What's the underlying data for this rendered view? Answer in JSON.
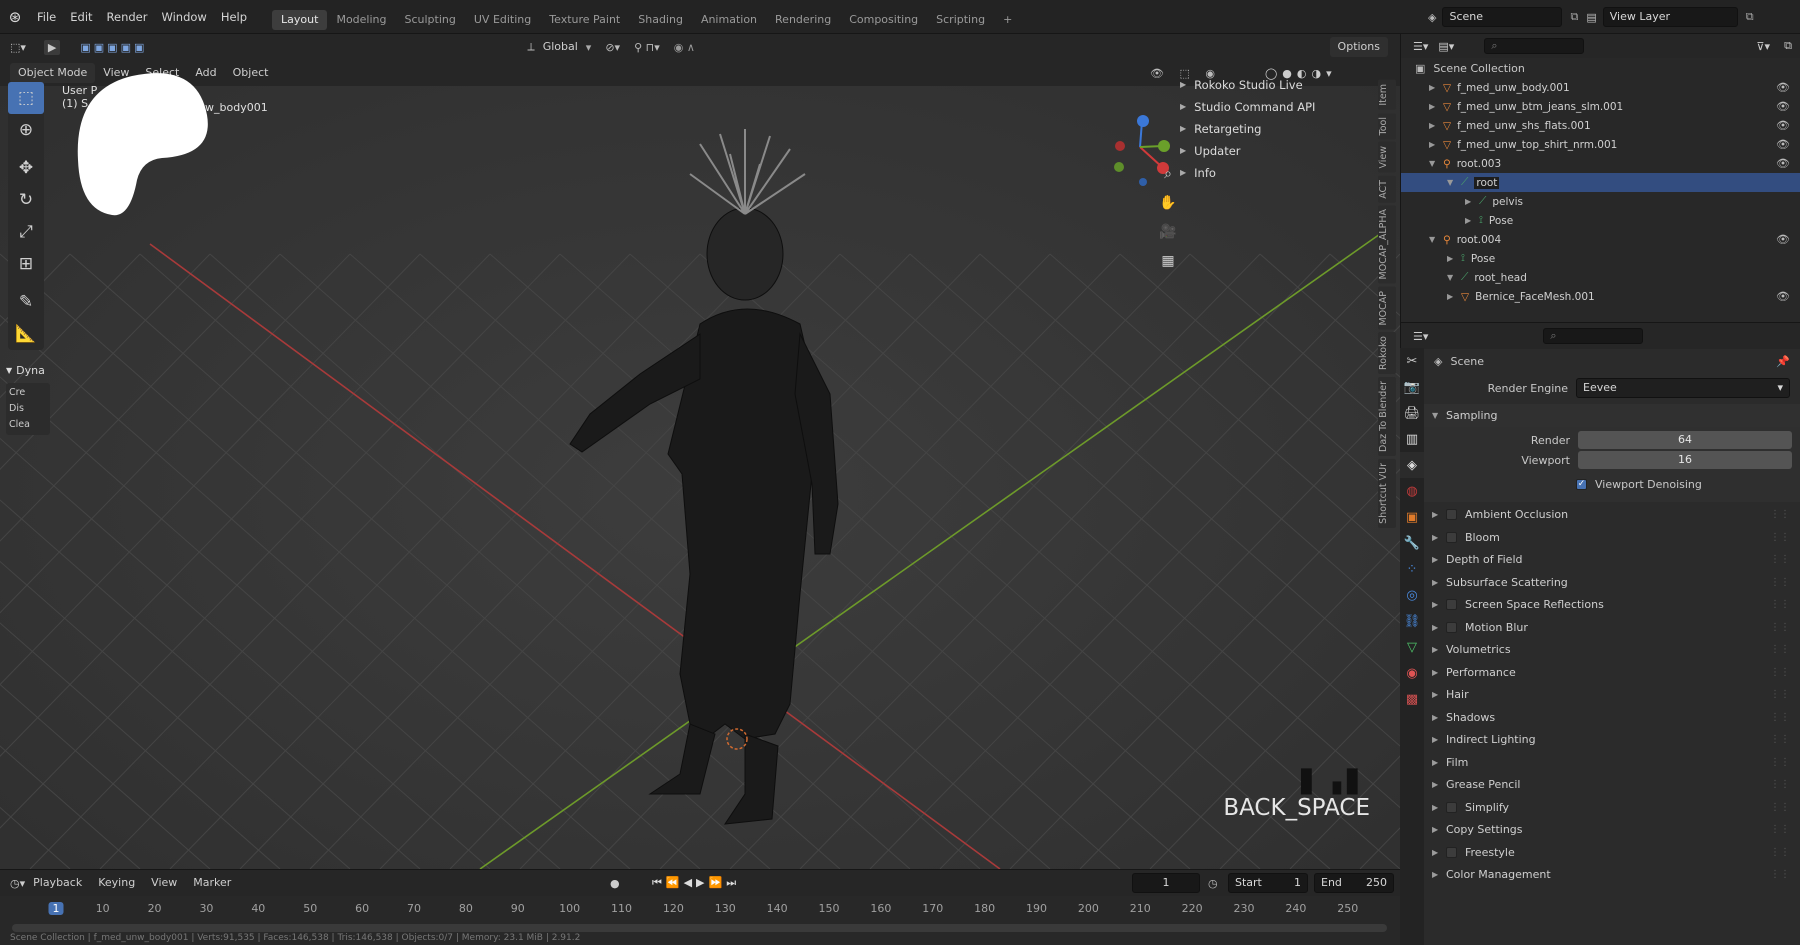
{
  "topbar": {
    "menus": [
      "File",
      "Edit",
      "Render",
      "Window",
      "Help"
    ],
    "workspaces": [
      "Layout",
      "Modeling",
      "Sculpting",
      "UV Editing",
      "Texture Paint",
      "Shading",
      "Animation",
      "Rendering",
      "Compositing",
      "Scripting"
    ],
    "active_workspace": "Layout",
    "add_tab": "+",
    "scene": "Scene",
    "view_layer": "View Layer"
  },
  "viewport_header": {
    "mode": "Object Mode",
    "menus": [
      "View",
      "Select",
      "Add",
      "Object"
    ],
    "orientation": "Global",
    "options": "Options"
  },
  "viewport": {
    "overlay_title": "User P",
    "overlay_sub": "(1) S",
    "overlay_obj": "w_body001",
    "left_panel_title": "Dyna",
    "left_panel_items": [
      "Cre",
      "Dis",
      "Clea"
    ],
    "watermark": "BACK_SPACE",
    "npanel_items": [
      "Rokoko Studio Live",
      "Studio Command API",
      "Retargeting",
      "Updater",
      "Info"
    ],
    "side_tabs": [
      "Item",
      "Tool",
      "View",
      "ACT",
      "MOCAP_ALPHA",
      "MOCAP",
      "Rokoko",
      "Daz To Blender",
      "Shortcut VUr"
    ]
  },
  "timeline": {
    "menus": [
      "Playback",
      "Keying",
      "View",
      "Marker"
    ],
    "current_frame": "1",
    "start_label": "Start",
    "start": "1",
    "end_label": "End",
    "end": "250",
    "ticks": [
      "1",
      "10",
      "20",
      "30",
      "40",
      "50",
      "60",
      "70",
      "80",
      "90",
      "100",
      "110",
      "120",
      "130",
      "140",
      "150",
      "160",
      "170",
      "180",
      "190",
      "200",
      "210",
      "220",
      "230",
      "240",
      "250"
    ],
    "status": "Scene Collection | f_med_unw_body001 | Verts:91,535 | Faces:146,538 | Tris:146,538 | Objects:0/7 | Memory: 23.1 MiB | 2.91.2"
  },
  "outliner": {
    "root": "Scene Collection",
    "items": [
      {
        "label": "f_med_unw_body.001",
        "depth": 1,
        "icon": "mesh",
        "eye": true
      },
      {
        "label": "f_med_unw_btm_jeans_slm.001",
        "depth": 1,
        "icon": "mesh",
        "eye": true
      },
      {
        "label": "f_med_unw_shs_flats.001",
        "depth": 1,
        "icon": "mesh",
        "eye": true
      },
      {
        "label": "f_med_unw_top_shirt_nrm.001",
        "depth": 1,
        "icon": "mesh",
        "eye": true
      },
      {
        "label": "root.003",
        "depth": 1,
        "icon": "armature",
        "eye": true
      },
      {
        "label": "root",
        "depth": 2,
        "icon": "bone",
        "eye": false,
        "selected": true
      },
      {
        "label": "pelvis",
        "depth": 3,
        "icon": "bone",
        "eye": false
      },
      {
        "label": "Pose",
        "depth": 3,
        "icon": "pose",
        "eye": false
      },
      {
        "label": "root.004",
        "depth": 1,
        "icon": "armature",
        "eye": true
      },
      {
        "label": "Pose",
        "depth": 2,
        "icon": "pose",
        "eye": false
      },
      {
        "label": "root_head",
        "depth": 2,
        "icon": "bone",
        "eye": false
      },
      {
        "label": "Bernice_FaceMesh.001",
        "depth": 2,
        "icon": "mesh",
        "eye": true
      }
    ]
  },
  "properties": {
    "context": "Scene",
    "render_engine_label": "Render Engine",
    "render_engine": "Eevee",
    "sampling_label": "Sampling",
    "render_label": "Render",
    "render_value": "64",
    "viewport_label": "Viewport",
    "viewport_value": "16",
    "viewport_denoising": "Viewport Denoising",
    "panels": [
      {
        "label": "Ambient Occlusion",
        "checkbox": true
      },
      {
        "label": "Bloom",
        "checkbox": true
      },
      {
        "label": "Depth of Field",
        "checkbox": false
      },
      {
        "label": "Subsurface Scattering",
        "checkbox": false
      },
      {
        "label": "Screen Space Reflections",
        "checkbox": true
      },
      {
        "label": "Motion Blur",
        "checkbox": true
      },
      {
        "label": "Volumetrics",
        "checkbox": false
      },
      {
        "label": "Performance",
        "checkbox": false
      },
      {
        "label": "Hair",
        "checkbox": false
      },
      {
        "label": "Shadows",
        "checkbox": false
      },
      {
        "label": "Indirect Lighting",
        "checkbox": false
      },
      {
        "label": "Film",
        "checkbox": false
      },
      {
        "label": "Grease Pencil",
        "checkbox": false
      },
      {
        "label": "Simplify",
        "checkbox": true
      },
      {
        "label": "Copy Settings",
        "checkbox": false
      },
      {
        "label": "Freestyle",
        "checkbox": true
      },
      {
        "label": "Color Management",
        "checkbox": false
      }
    ]
  },
  "colors": {
    "accent": "#4772b3",
    "selected": "#334d80",
    "x_axis": "#a83a3a",
    "y_axis": "#6d9a2a"
  }
}
